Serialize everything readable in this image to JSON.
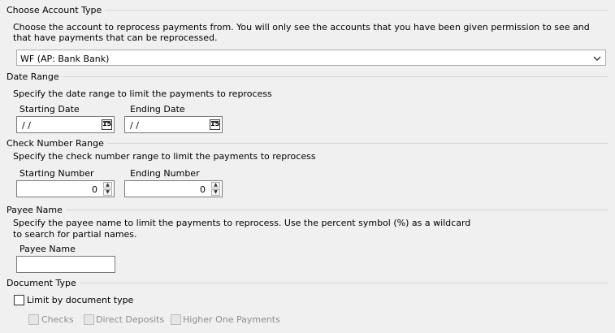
{
  "account": {
    "title": "Choose Account Type",
    "description": "Choose the account to reprocess payments from.  You will only see the accounts that you have been given permission to see and that have payments that can be reprocessed.",
    "selected": "WF (AP: Bank Bank)"
  },
  "date_range": {
    "title": "Date Range",
    "description": "Specify the date range to limit the payments to reprocess",
    "start_label": "Starting Date",
    "start_value": " / /",
    "end_label": "Ending Date",
    "end_value": " / /",
    "calendar_glyph": "15"
  },
  "check_range": {
    "title": "Check Number Range",
    "description": "Specify the check number range to limit the payments to reprocess",
    "start_label": "Starting Number",
    "start_value": "0",
    "end_label": "Ending Number",
    "end_value": "0"
  },
  "payee": {
    "title": "Payee Name",
    "description_line1": "Specify the payee name to limit the payments to reprocess. Use the percent symbol (%) as a wildcard",
    "description_line2": "to search for partial names.",
    "label": "Payee Name",
    "value": ""
  },
  "document_type": {
    "title": "Document Type",
    "limit_label": "Limit by document type",
    "limit_checked": false,
    "options": [
      {
        "label": "Checks",
        "checked": false,
        "enabled": false
      },
      {
        "label": "Direct Deposits",
        "checked": false,
        "enabled": false
      },
      {
        "label": "Higher One Payments",
        "checked": false,
        "enabled": false
      }
    ]
  }
}
